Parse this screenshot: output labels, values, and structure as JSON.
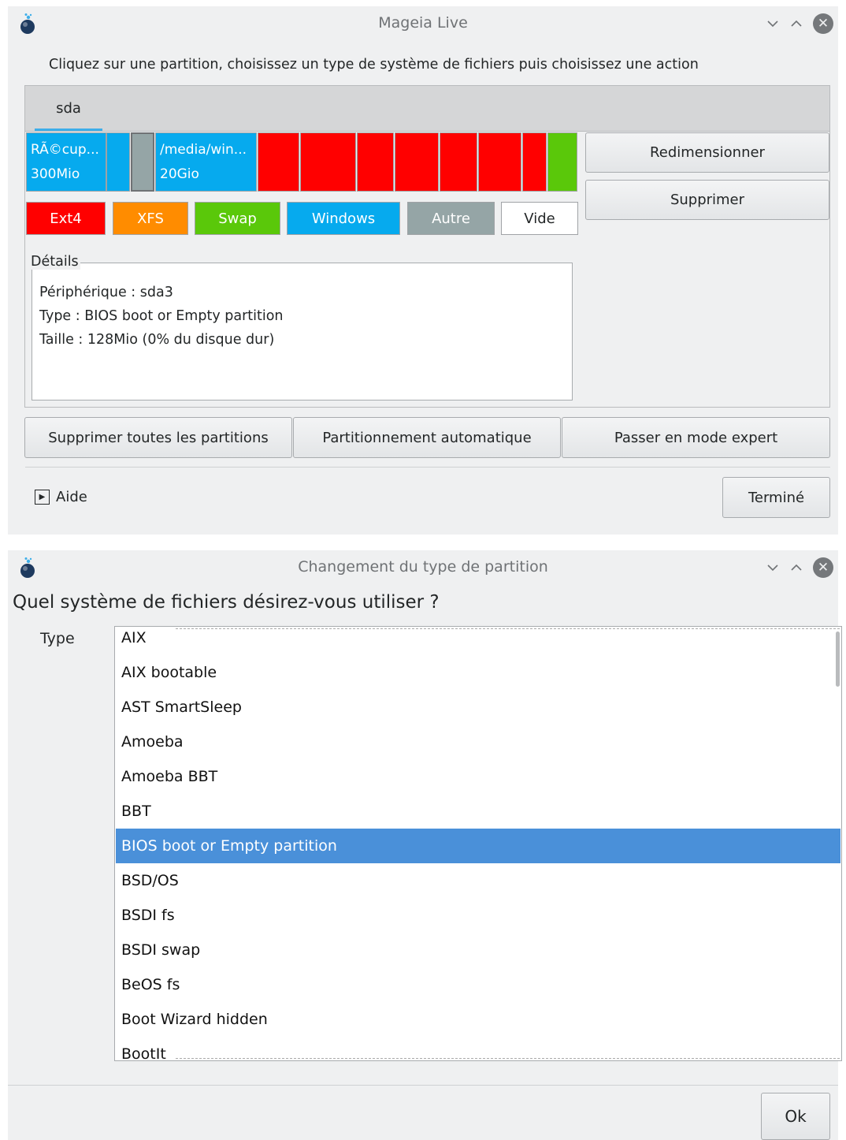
{
  "colors": {
    "ext4": "#ff0000",
    "xfs": "#ff8c00",
    "swap": "#5ac80a",
    "windows": "#06aaee",
    "autre": "#95a5a6",
    "vide": "#ffffff",
    "selection": "#4a90d9"
  },
  "window1": {
    "title": "Mageia Live",
    "icon": "mageia-logo-icon",
    "instruction": "Cliquez sur une partition, choisissez un type de système de fichiers puis choisissez une action",
    "tab": "sda",
    "partitions": [
      {
        "type": "windows",
        "label": "RÃ©cup...",
        "size": "300Mio"
      },
      {
        "type": "windows",
        "label": "",
        "size": ""
      },
      {
        "type": "autre",
        "label": "",
        "size": ""
      },
      {
        "type": "windows",
        "label": "/media/win...",
        "size": "20Gio"
      },
      {
        "type": "ext4",
        "label": "",
        "size": ""
      },
      {
        "type": "ext4",
        "label": "",
        "size": ""
      },
      {
        "type": "ext4",
        "label": "",
        "size": ""
      },
      {
        "type": "ext4",
        "label": "",
        "size": ""
      },
      {
        "type": "ext4",
        "label": "",
        "size": ""
      },
      {
        "type": "ext4",
        "label": "",
        "size": ""
      },
      {
        "type": "ext4",
        "label": "",
        "size": ""
      },
      {
        "type": "swap",
        "label": "",
        "size": ""
      },
      {
        "type": "vide",
        "label": "",
        "size": ""
      }
    ],
    "legend": {
      "ext4": "Ext4",
      "xfs": "XFS",
      "swap": "Swap",
      "windows": "Windows",
      "autre": "Autre",
      "vide": "Vide"
    },
    "actions": {
      "resize": "Redimensionner",
      "delete": "Supprimer"
    },
    "details": {
      "title": "Détails",
      "device": "Périphérique : sda3",
      "type": "Type : BIOS boot or Empty partition",
      "size": "Taille : 128Mio (0% du disque dur)"
    },
    "buttons": {
      "delete_all": "Supprimer toutes les partitions",
      "auto": "Partitionnement automatique",
      "expert": "Passer en mode expert",
      "done": "Terminé"
    },
    "help": "Aide"
  },
  "window2": {
    "title": "Changement du type de partition",
    "question": "Quel système de fichiers désirez-vous utiliser ?",
    "type_label": "Type",
    "selected": "BIOS boot or Empty partition",
    "items": [
      "AIX",
      "AIX bootable",
      "AST SmartSleep",
      "Amoeba",
      "Amoeba BBT",
      "BBT",
      "BIOS boot or Empty partition",
      "BSD/OS",
      "BSDI fs",
      "BSDI swap",
      "BeOS fs",
      "Boot Wizard hidden",
      "BootIt"
    ],
    "ok": "Ok"
  }
}
